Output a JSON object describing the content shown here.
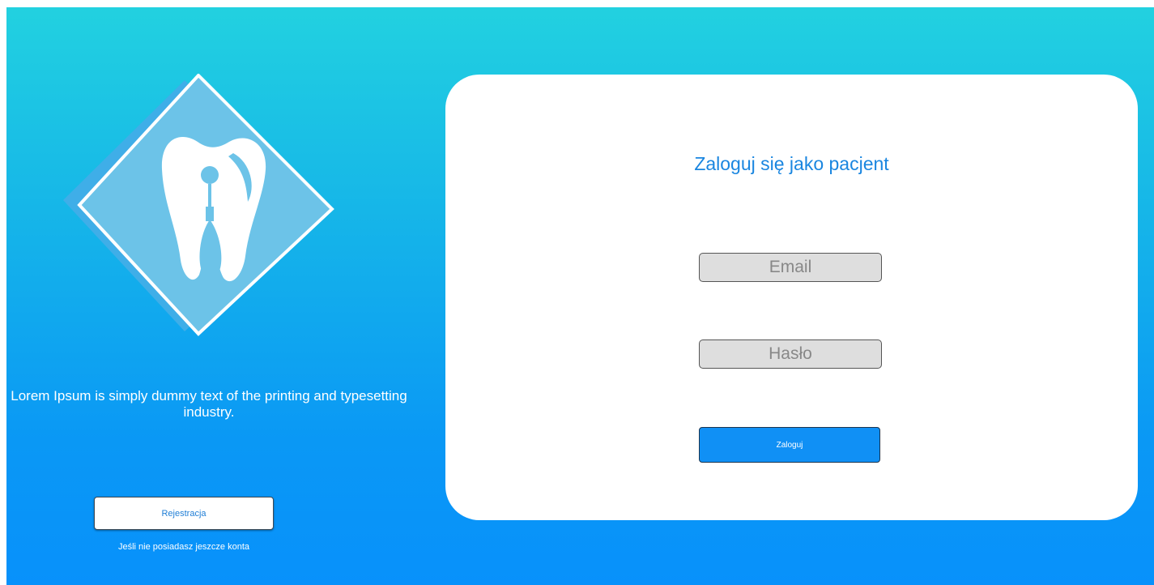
{
  "brand": {
    "tagline": "Lorem Ipsum is simply dummy text of the printing and typesetting industry.",
    "logo_icon": "tooth-icon"
  },
  "register": {
    "button_label": "Rejestracja",
    "hint": "Jeśli nie posiadasz jeszcze konta"
  },
  "login": {
    "title": "Zaloguj się jako pacjent",
    "email_placeholder": "Email",
    "email_value": "",
    "password_placeholder": "Hasło",
    "password_value": "",
    "submit_label": "Zaloguj"
  },
  "colors": {
    "gradient_top": "#22d1e0",
    "gradient_bottom": "#0891fb",
    "accent": "#1090f5",
    "title": "#1a86e0",
    "logo_fill": "#6cc3e8"
  }
}
